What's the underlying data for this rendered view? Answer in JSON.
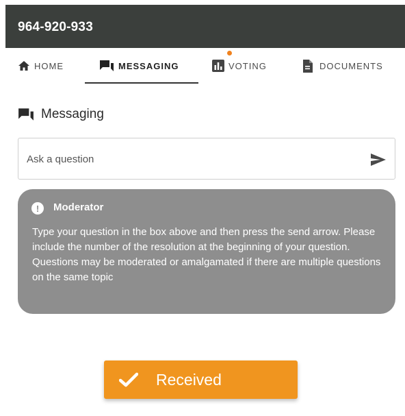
{
  "header": {
    "meeting_id": "964-920-933",
    "background_color": "#3b3f3c"
  },
  "tabs": [
    {
      "label": "HOME",
      "icon": "home-icon",
      "active": false
    },
    {
      "label": "MESSAGING",
      "icon": "chat-icon",
      "active": true
    },
    {
      "label": "VOTING",
      "icon": "bar-chart-icon",
      "active": false,
      "notification_dot": true
    },
    {
      "label": "DOCUMENTS",
      "icon": "document-icon",
      "active": false
    }
  ],
  "messaging": {
    "title": "Messaging",
    "title_icon": "chat-icon",
    "input_placeholder": "Ask a question",
    "send_icon": "send-icon"
  },
  "moderator": {
    "name": "Moderator",
    "icon": "alert-icon",
    "message": "Type your question in the box above and then press the send arrow. Please include the number of the resolution at the beginning of your question. Questions may be moderated or amalgamated if there are multiple questions on the same topic",
    "card_color": "#8e8e8e"
  },
  "toast": {
    "label": "Received",
    "icon": "check-icon",
    "color": "#f0951f"
  },
  "accent_color": "#f0821e"
}
